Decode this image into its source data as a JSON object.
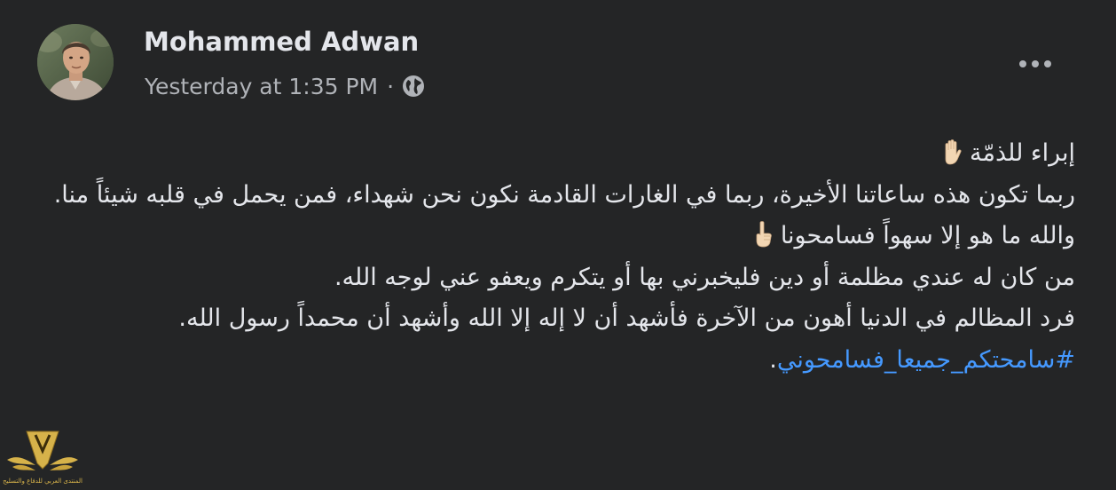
{
  "post": {
    "author": "Mohammed Adwan",
    "timestamp": "Yesterday at 1:35 PM",
    "separator": "·",
    "audience_icon": "globe-icon",
    "menu_icon": "more-options-icon",
    "body": {
      "line1": "إبراء للذمّة",
      "line2": "ربما تكون هذه ساعاتنا الأخيرة، ربما في الغارات القادمة نكون نحن شهداء، فمن يحمل في قلبه شيئاً منا.",
      "line3": "والله ما هو إلا سهواً فسامحونا",
      "line4": "من كان له عندي مظلمة أو دين فليخبرني بها أو يتكرم ويعفو عني لوجه الله.",
      "line5": "فرد المظالم في الدنيا أهون من الآخرة فأشهد أن لا إله إلا الله وأشهد أن محمداً رسول الله.",
      "hashtag": "#سامحتكم_جميعا_فسامحوني",
      "hashtag_suffix": "."
    },
    "emojis": {
      "raised_hand": "raised-hand-emoji",
      "index_pointing_up": "index-pointing-up-emoji"
    }
  },
  "watermark": {
    "text": "المنتدى العربي للدفاع والتسليح"
  },
  "colors": {
    "background": "#242526",
    "primary_text": "#e4e6eb",
    "secondary_text": "#b0b3b8",
    "link": "#4599ff",
    "watermark_gold": "#d6b24a"
  }
}
